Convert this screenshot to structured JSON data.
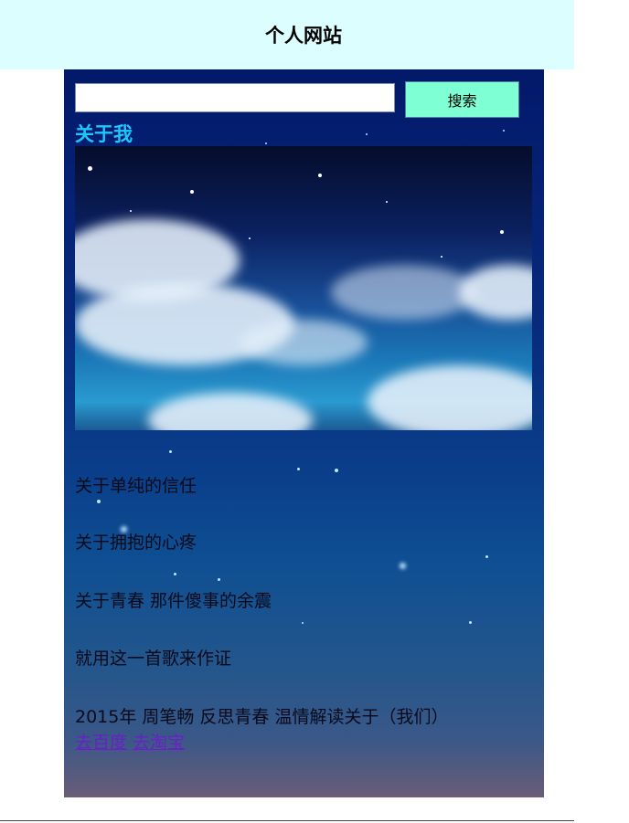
{
  "header": {
    "title": "个人网站"
  },
  "search": {
    "value": "",
    "button_label": "搜索"
  },
  "about": {
    "title": "关于我"
  },
  "lines": [
    "关于单纯的信任",
    "关于拥抱的心疼",
    "关于青春 那件傻事的余震",
    "就用这一首歌来作证",
    "2015年 周笔畅 反思青春 温情解读关于（我们）"
  ],
  "links": {
    "baidu": "去百度",
    "taobao": "去淘宝"
  }
}
